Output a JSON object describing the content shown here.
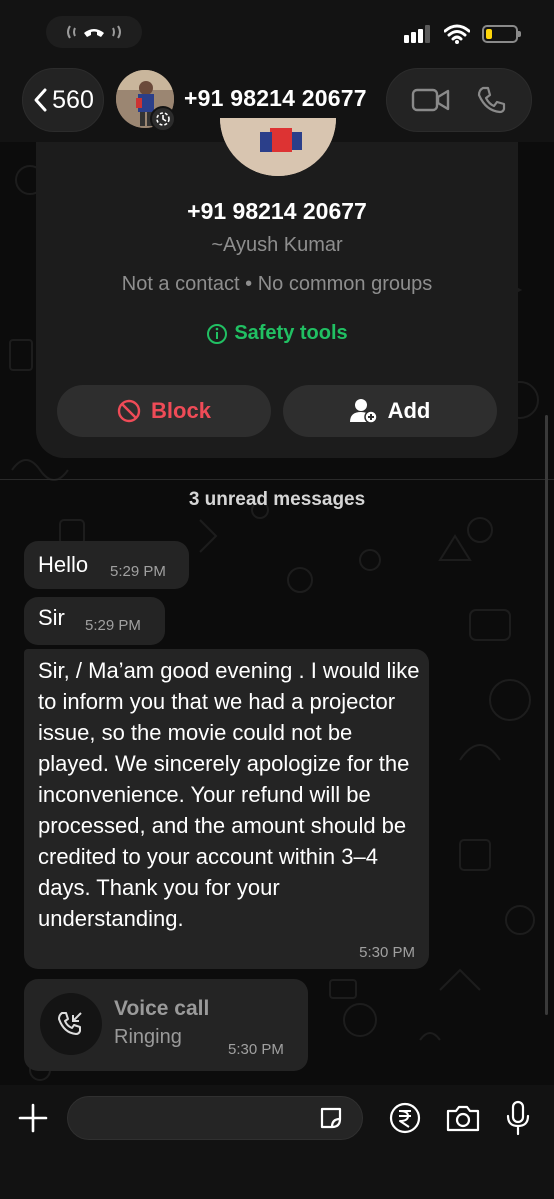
{
  "status_bar": {
    "call_indicator_icon": "phone-active-icon",
    "signal_icon": "cellular-signal-icon",
    "wifi_icon": "wifi-icon",
    "battery_color": "#ffd60a"
  },
  "header": {
    "back_count": "560",
    "title": "+91 98214 20677",
    "video_icon": "video-camera-icon",
    "phone_icon": "phone-icon"
  },
  "contact_card": {
    "phone": "+91 98214 20677",
    "name": "~Ayush Kumar",
    "meta": "Not a contact • No common groups",
    "safety_label": "Safety tools",
    "block_label": "Block",
    "add_label": "Add"
  },
  "unread_label": "3 unread messages",
  "messages": [
    {
      "text": "Hello",
      "time": "5:29 PM"
    },
    {
      "text": "Sir",
      "time": "5:29 PM"
    },
    {
      "text": "Sir, / Ma’am good evening . I would like to inform you that we had a projector issue, so the movie could not be played. We sincerely apologize for the inconvenience. Your refund will be processed, and the amount should be credited to your account within 3–4 days. Thank you for your understanding.",
      "time": "5:30 PM"
    }
  ],
  "call_message": {
    "title": "Voice call",
    "status": "Ringing",
    "time": "5:30 PM"
  },
  "composer": {
    "placeholder": "",
    "icons": [
      "plus-icon",
      "sticker-icon",
      "rupee-icon",
      "camera-icon",
      "mic-icon"
    ]
  },
  "colors": {
    "accent_green": "#21c063",
    "block_red": "#ef4b57"
  }
}
